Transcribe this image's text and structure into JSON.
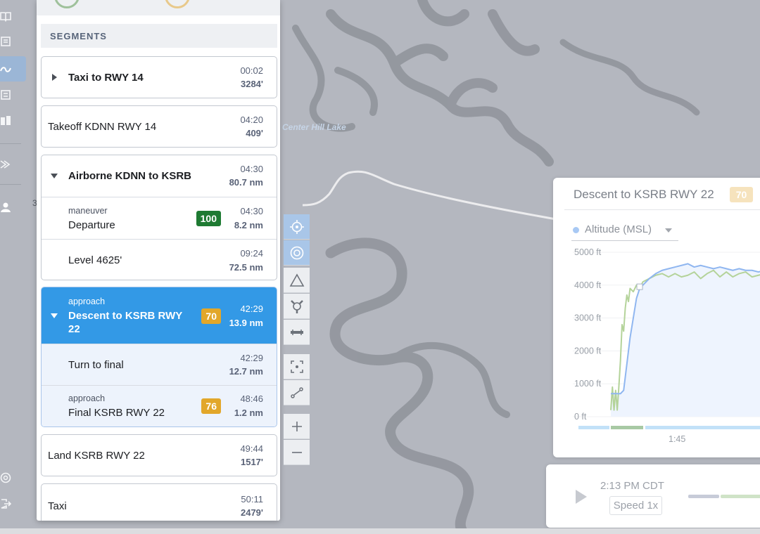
{
  "map": {
    "lake_label": "Center Hill Lake",
    "side_number": "3"
  },
  "panel": {
    "header": "SEGMENTS",
    "segments": [
      {
        "title": "Taxi to RWY 14",
        "time": "00:02",
        "distance": "3284'"
      },
      {
        "title": "Takeoff KDNN RWY 14",
        "time": "04:20",
        "distance": "409'"
      },
      {
        "title": "Airborne KDNN to KSRB",
        "time": "04:30",
        "distance": "80.7 nm",
        "children": [
          {
            "type": "maneuver",
            "title": "Departure",
            "score": "100",
            "time": "04:30",
            "distance": "8.2 nm"
          },
          {
            "title": "Level 4625'",
            "time": "09:24",
            "distance": "72.5 nm"
          }
        ]
      },
      {
        "type": "approach",
        "title": "Descent to KSRB RWY 22",
        "score": "70",
        "time": "42:29",
        "distance": "13.9 nm",
        "children": [
          {
            "title": "Turn to final",
            "time": "42:29",
            "distance": "12.7 nm"
          },
          {
            "type": "approach",
            "title": "Final KSRB RWY 22",
            "score": "76",
            "time": "48:46",
            "distance": "1.2 nm"
          }
        ]
      },
      {
        "title": "Land KSRB RWY 22",
        "time": "49:44",
        "distance": "1517'"
      },
      {
        "title": "Taxi",
        "time": "50:11",
        "distance": "2479'"
      }
    ]
  },
  "colors": {
    "selected": "#3399e6",
    "score_green": "#1e7a32",
    "score_amber": "#e2a72a",
    "altitude_line": "#8fb6f0",
    "ground_line": "#b4d39a"
  },
  "chart_card": {
    "title": "Descent to KSRB RWY 22",
    "score": "70",
    "series_select": "Altitude (MSL)"
  },
  "chart_data": {
    "type": "line",
    "ylim": [
      0,
      5000
    ],
    "yticks": [
      "5000 ft",
      "4000 ft",
      "3000 ft",
      "2000 ft",
      "1000 ft",
      "0 ft"
    ],
    "xticks": [
      "1:45"
    ],
    "series": [
      {
        "name": "Altitude (MSL)",
        "x": [
          0,
          2,
          4,
          6,
          8,
          10,
          12,
          14,
          16,
          18,
          20,
          24,
          28,
          32,
          36,
          40,
          44,
          48,
          52,
          56,
          60,
          64,
          68,
          72,
          76,
          80,
          84,
          88,
          92,
          96,
          100
        ],
        "y": [
          700,
          700,
          700,
          700,
          800,
          1600,
          2400,
          3000,
          3600,
          3900,
          4000,
          4200,
          4350,
          4450,
          4500,
          4550,
          4600,
          4650,
          4550,
          4600,
          4550,
          4500,
          4550,
          4500,
          4450,
          4500,
          4450,
          4450,
          4400,
          4450,
          4400
        ]
      },
      {
        "name": "",
        "x": [
          0,
          1,
          2,
          3,
          4,
          5,
          6,
          7,
          8,
          9,
          10,
          11,
          12,
          14,
          16,
          18,
          20,
          24,
          28,
          32,
          36,
          40,
          44,
          48,
          52,
          56,
          60,
          64,
          68,
          72,
          76,
          80,
          84,
          88,
          92,
          96,
          100
        ],
        "y": [
          200,
          900,
          200,
          800,
          200,
          900,
          1700,
          2800,
          2600,
          3300,
          3700,
          3500,
          3900,
          3800,
          4000,
          3900,
          4100,
          4200,
          4300,
          4350,
          4250,
          4350,
          4250,
          4300,
          4400,
          4200,
          4350,
          4450,
          4250,
          4400,
          4250,
          4350,
          4400,
          4250,
          4300,
          4350,
          4250
        ]
      }
    ]
  },
  "playback": {
    "time": "2:13 PM CDT",
    "speed": "Speed 1x"
  }
}
